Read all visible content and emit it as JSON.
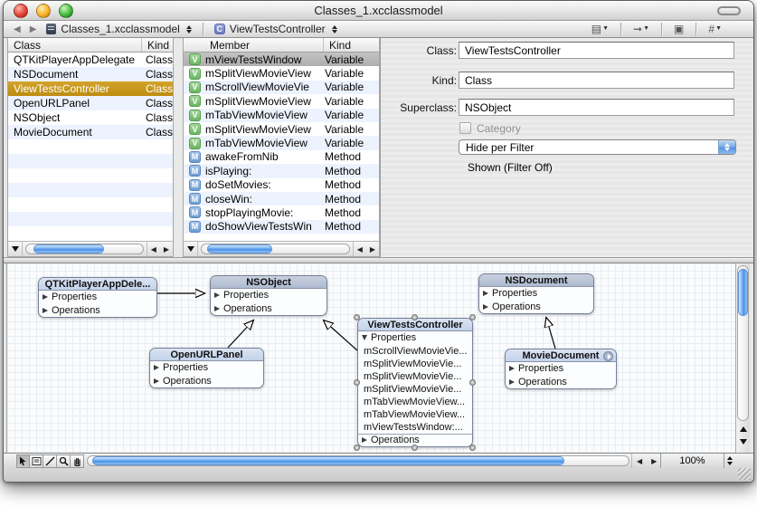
{
  "window": {
    "title": "Classes_1.xcclassmodel"
  },
  "navbar": {
    "back_icon": "◀",
    "forward_icon": "▶",
    "model_popup": {
      "label": "Classes_1.xcclassmodel"
    },
    "class_popup": {
      "label": "ViewTestsController",
      "icon_letter": "C"
    },
    "right_icons": {
      "pages": "▤",
      "arrow": "➞",
      "copy": "▣",
      "hash": "#"
    }
  },
  "class_list": {
    "columns": {
      "c1": "Class",
      "c2": "Kind"
    },
    "rows": [
      {
        "name": "QTKitPlayerAppDelegate",
        "kind": "Class"
      },
      {
        "name": "NSDocument",
        "kind": "Class"
      },
      {
        "name": "ViewTestsController",
        "kind": "Class"
      },
      {
        "name": "OpenURLPanel",
        "kind": "Class"
      },
      {
        "name": "NSObject",
        "kind": "Class"
      },
      {
        "name": "MovieDocument",
        "kind": "Class"
      }
    ]
  },
  "member_list": {
    "columns": {
      "c1": "Member",
      "c2": "Kind"
    },
    "rows": [
      {
        "badge": "V",
        "name": "mViewTestsWindow",
        "kind": "Variable"
      },
      {
        "badge": "V",
        "name": "mSplitViewMovieView",
        "kind": "Variable"
      },
      {
        "badge": "V",
        "name": "mScrollViewMovieVie",
        "kind": "Variable"
      },
      {
        "badge": "V",
        "name": "mSplitViewMovieView",
        "kind": "Variable"
      },
      {
        "badge": "V",
        "name": "mTabViewMovieView",
        "kind": "Variable"
      },
      {
        "badge": "V",
        "name": "mSplitViewMovieView",
        "kind": "Variable"
      },
      {
        "badge": "V",
        "name": "mTabViewMovieView",
        "kind": "Variable"
      },
      {
        "badge": "M",
        "name": "awakeFromNib",
        "kind": "Method"
      },
      {
        "badge": "M",
        "name": "isPlaying:",
        "kind": "Method"
      },
      {
        "badge": "M",
        "name": "doSetMovies:",
        "kind": "Method"
      },
      {
        "badge": "M",
        "name": "closeWin:",
        "kind": "Method"
      },
      {
        "badge": "M",
        "name": "stopPlayingMovie:",
        "kind": "Method"
      },
      {
        "badge": "M",
        "name": "doShowViewTestsWin",
        "kind": "Method"
      }
    ]
  },
  "details": {
    "class_label": "Class:",
    "class_value": "ViewTestsController",
    "kind_label": "Kind:",
    "kind_value": "Class",
    "superclass_label": "Superclass:",
    "superclass_value": "NSObject",
    "category_label": "Category",
    "filter_popup_value": "Hide per Filter",
    "filter_status": "Shown (Filter Off)"
  },
  "diagram": {
    "boxes": {
      "qtkit": {
        "title": "QTKitPlayerAppDele...",
        "properties": "Properties",
        "operations": "Operations"
      },
      "nsobject": {
        "title": "NSObject",
        "properties": "Properties",
        "operations": "Operations"
      },
      "openurl": {
        "title": "OpenURLPanel",
        "properties": "Properties",
        "operations": "Operations"
      },
      "nsdoc": {
        "title": "NSDocument",
        "properties": "Properties",
        "operations": "Operations"
      },
      "moviedoc": {
        "title": "MovieDocument",
        "properties": "Properties",
        "operations": "Operations"
      },
      "vtc": {
        "title": "ViewTestsController",
        "properties": "Properties",
        "operations": "Operations",
        "members": [
          "mScrollViewMovieVie...",
          "mSplitViewMovieVie...",
          "mSplitViewMovieVie...",
          "mSplitViewMovieVie...",
          "mTabViewMovieView...",
          "mTabViewMovieView...",
          "mViewTestsWindow:..."
        ]
      }
    }
  },
  "statusbar": {
    "zoom_value": "100%"
  },
  "colors": {
    "selection_gold": "#c79217",
    "selection_gray": "#b5b5b5",
    "row_stripe_blue": "#edf3fe",
    "variable_green": "#6cb662",
    "method_blue": "#6d9cd2",
    "aqua_scrollbar_blue": "#4a90e8"
  }
}
